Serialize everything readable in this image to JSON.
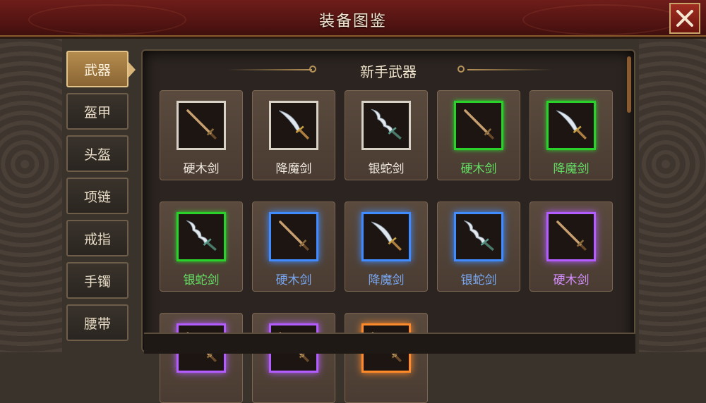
{
  "header": {
    "title": "装备图鉴",
    "close_icon": "close-icon"
  },
  "sidebar": {
    "items": [
      {
        "label": "武器",
        "active": true
      },
      {
        "label": "盔甲",
        "active": false
      },
      {
        "label": "头盔",
        "active": false
      },
      {
        "label": "项链",
        "active": false
      },
      {
        "label": "戒指",
        "active": false
      },
      {
        "label": "手镯",
        "active": false
      },
      {
        "label": "腰带",
        "active": false
      }
    ]
  },
  "section": {
    "title": "新手武器"
  },
  "colors": {
    "white": "#d8d2c6",
    "green": "#2bd12b",
    "blue": "#3f8bff",
    "purple": "#b35cff",
    "orange": "#ff8a2a"
  },
  "items": [
    {
      "name": "硬木剑",
      "icon": "wooden-sword-icon",
      "quality": "white"
    },
    {
      "name": "降魔剑",
      "icon": "demon-sword-icon",
      "quality": "white"
    },
    {
      "name": "银蛇剑",
      "icon": "silver-snake-sword-icon",
      "quality": "white"
    },
    {
      "name": "硬木剑",
      "icon": "wooden-sword-icon",
      "quality": "green"
    },
    {
      "name": "降魔剑",
      "icon": "demon-sword-icon",
      "quality": "green"
    },
    {
      "name": "银蛇剑",
      "icon": "silver-snake-sword-icon",
      "quality": "green"
    },
    {
      "name": "硬木剑",
      "icon": "wooden-sword-icon",
      "quality": "blue"
    },
    {
      "name": "降魔剑",
      "icon": "demon-sword-icon",
      "quality": "blue"
    },
    {
      "name": "银蛇剑",
      "icon": "silver-snake-sword-icon",
      "quality": "blue"
    },
    {
      "name": "硬木剑",
      "icon": "wooden-sword-icon",
      "quality": "purple"
    },
    {
      "name": "",
      "icon": "sword-icon",
      "quality": "purple"
    },
    {
      "name": "",
      "icon": "sword-icon",
      "quality": "purple"
    },
    {
      "name": "",
      "icon": "sword-icon",
      "quality": "orange"
    }
  ]
}
